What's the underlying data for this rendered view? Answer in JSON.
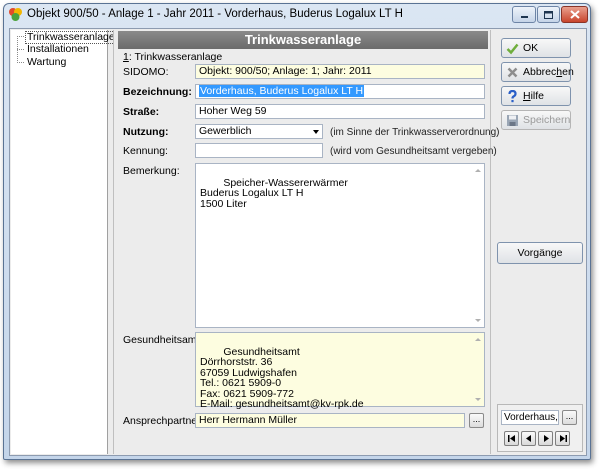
{
  "window": {
    "title": "Objekt 900/50 - Anlage 1 - Jahr 2011 - Vorderhaus, Buderus Logalux LT H"
  },
  "tree": {
    "items": [
      "Trinkwasseranlage",
      "Installationen",
      "Wartung"
    ]
  },
  "section": {
    "header": "Trinkwasseranlage",
    "subtitle_hotkey": "1",
    "subtitle_rest": ": Trinkwasseranlage"
  },
  "form": {
    "sidomo_label": "SIDOMO:",
    "sidomo_value": "Objekt: 900/50;  Anlage: 1;  Jahr: 2011",
    "bezeichnung_label": "Bezeichnung:",
    "bezeichnung_value": "Vorderhaus, Buderus Logalux LT H",
    "strasse_label": "Straße:",
    "strasse_value": "Hoher Weg 59",
    "nutzung_label": "Nutzung:",
    "nutzung_value": "Gewerblich",
    "nutzung_hint": "(im Sinne der Trinkwasserverordnung)",
    "kennung_label": "Kennung:",
    "kennung_value": "",
    "kennung_hint": "(wird vom Gesundheitsamt vergeben)",
    "bemerkung_label": "Bemerkung:",
    "bemerkung_value": "Speicher-Wassererwärmer\nBuderus Logalux LT H\n1500 Liter",
    "gesundheitsamt_label": "Gesundheitsamt:",
    "gesundheitsamt_value": "Gesundheitsamt\nDörrhorststr. 36\n67059 Ludwigshafen\nTel.: 0621 5909-0\nFax: 0621 5909-772\nE-Mail: gesundheitsamt@kv-rpk.de",
    "ansprechpartner_label": "Ansprechpartner:",
    "ansprechpartner_value": "Herr Hermann Müller",
    "dots": "..."
  },
  "buttons": {
    "ok": "OK",
    "abbrechen": "Abbrechen",
    "hilfe": "Hilfe",
    "speichern": "Speichern",
    "vorgaenge": "Vorgänge"
  },
  "navigator": {
    "record": "Vorderhaus, B"
  },
  "colors": {
    "header_bg": "#7a7a7a",
    "readonly_bg": "#fdfde0",
    "selection": "#3399ff",
    "ok_icon": "#6fae3c",
    "help_icon": "#2a5fc7"
  },
  "icons": {
    "ok": "checkmark-icon",
    "abbrechen": "cross-icon",
    "hilfe": "question-icon",
    "speichern": "disk-icon"
  }
}
